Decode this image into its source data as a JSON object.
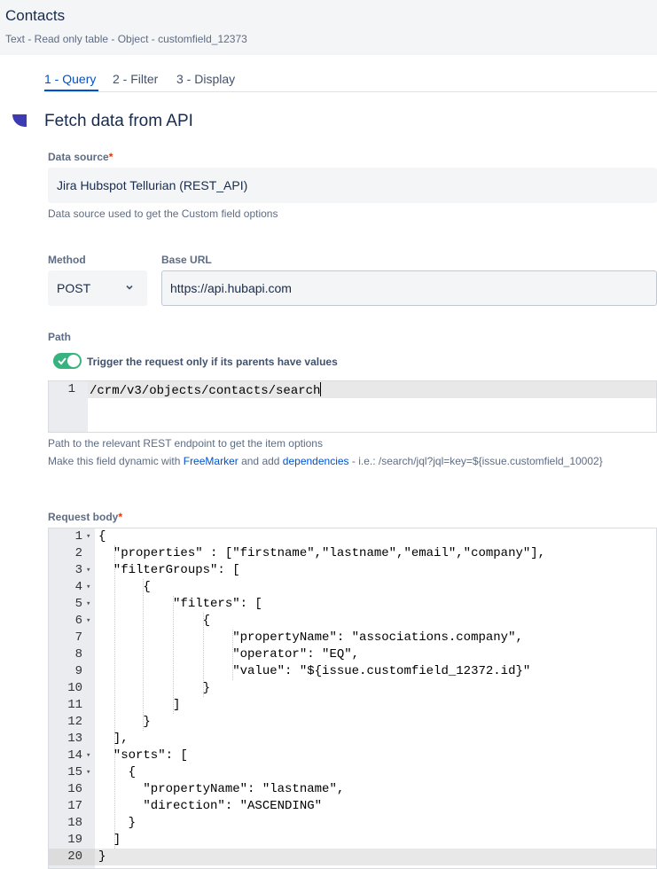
{
  "header": {
    "title": "Contacts",
    "subtitle": "Text - Read only table - Object - customfield_12373"
  },
  "tabs": [
    {
      "label": "1 - Query",
      "active": true
    },
    {
      "label": "2 - Filter",
      "active": false
    },
    {
      "label": "3 - Display",
      "active": false
    }
  ],
  "section": {
    "title": "Fetch data from API"
  },
  "data_source": {
    "label": "Data source",
    "required_marker": "*",
    "value": "Jira Hubspot Tellurian (REST_API)",
    "help": "Data source used to get the Custom field options"
  },
  "method": {
    "label": "Method",
    "value": "POST"
  },
  "base_url": {
    "label": "Base URL",
    "value": "https://api.hubapi.com"
  },
  "path": {
    "label": "Path",
    "toggle_label": "Trigger the request only if its parents have values",
    "toggle_on": true,
    "line_number": "1",
    "code": "/crm/v3/objects/contacts/search",
    "help_line1": "Path to the relevant REST endpoint to get the item options",
    "help_line2_prefix": "Make this field dynamic with ",
    "help_link_freemarker": "FreeMarker",
    "help_line2_middle": " and add ",
    "help_link_dependencies": "dependencies",
    "help_line2_suffix": " - i.e.: /search/jql?jql=key=${issue.customfield_10002}"
  },
  "request_body": {
    "label": "Request body",
    "required_marker": "*",
    "lines": [
      {
        "n": "1",
        "fold": true,
        "text": "{"
      },
      {
        "n": "2",
        "fold": false,
        "text": "  \"properties\" : [\"firstname\",\"lastname\",\"email\",\"company\"],"
      },
      {
        "n": "3",
        "fold": true,
        "text": "  \"filterGroups\": ["
      },
      {
        "n": "4",
        "fold": true,
        "text": "      {"
      },
      {
        "n": "5",
        "fold": true,
        "text": "          \"filters\": ["
      },
      {
        "n": "6",
        "fold": true,
        "text": "              {"
      },
      {
        "n": "7",
        "fold": false,
        "text": "                  \"propertyName\": \"associations.company\","
      },
      {
        "n": "8",
        "fold": false,
        "text": "                  \"operator\": \"EQ\","
      },
      {
        "n": "9",
        "fold": false,
        "text": "                  \"value\": \"${issue.customfield_12372.id}\""
      },
      {
        "n": "10",
        "fold": false,
        "text": "              }"
      },
      {
        "n": "11",
        "fold": false,
        "text": "          ]"
      },
      {
        "n": "12",
        "fold": false,
        "text": "      }"
      },
      {
        "n": "13",
        "fold": false,
        "text": "  ],"
      },
      {
        "n": "14",
        "fold": true,
        "text": "  \"sorts\": ["
      },
      {
        "n": "15",
        "fold": true,
        "text": "    {"
      },
      {
        "n": "16",
        "fold": false,
        "text": "      \"propertyName\": \"lastname\","
      },
      {
        "n": "17",
        "fold": false,
        "text": "      \"direction\": \"ASCENDING\""
      },
      {
        "n": "18",
        "fold": false,
        "text": "    }"
      },
      {
        "n": "19",
        "fold": false,
        "text": "  ]"
      },
      {
        "n": "20",
        "fold": false,
        "text": "}"
      }
    ]
  },
  "colors": {
    "accent": "#0052cc",
    "toggle_on": "#36b37e",
    "required": "#de350b",
    "section_marker": "#3d3bb3"
  },
  "icons": {
    "method_dropdown": "chevron-down-icon",
    "toggle_check": "check-icon",
    "fold_marker": "fold-arrow-icon"
  }
}
